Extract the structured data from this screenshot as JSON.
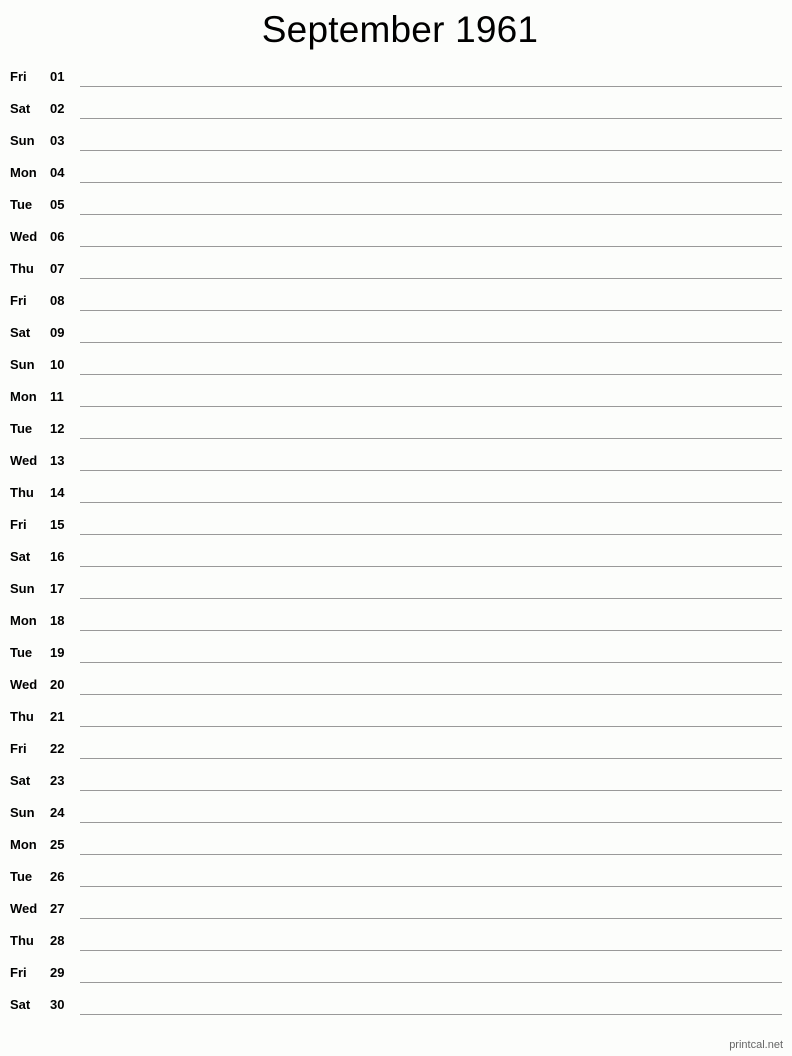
{
  "title": "September 1961",
  "days": [
    {
      "dow": "Fri",
      "day": "01"
    },
    {
      "dow": "Sat",
      "day": "02"
    },
    {
      "dow": "Sun",
      "day": "03"
    },
    {
      "dow": "Mon",
      "day": "04"
    },
    {
      "dow": "Tue",
      "day": "05"
    },
    {
      "dow": "Wed",
      "day": "06"
    },
    {
      "dow": "Thu",
      "day": "07"
    },
    {
      "dow": "Fri",
      "day": "08"
    },
    {
      "dow": "Sat",
      "day": "09"
    },
    {
      "dow": "Sun",
      "day": "10"
    },
    {
      "dow": "Mon",
      "day": "11"
    },
    {
      "dow": "Tue",
      "day": "12"
    },
    {
      "dow": "Wed",
      "day": "13"
    },
    {
      "dow": "Thu",
      "day": "14"
    },
    {
      "dow": "Fri",
      "day": "15"
    },
    {
      "dow": "Sat",
      "day": "16"
    },
    {
      "dow": "Sun",
      "day": "17"
    },
    {
      "dow": "Mon",
      "day": "18"
    },
    {
      "dow": "Tue",
      "day": "19"
    },
    {
      "dow": "Wed",
      "day": "20"
    },
    {
      "dow": "Thu",
      "day": "21"
    },
    {
      "dow": "Fri",
      "day": "22"
    },
    {
      "dow": "Sat",
      "day": "23"
    },
    {
      "dow": "Sun",
      "day": "24"
    },
    {
      "dow": "Mon",
      "day": "25"
    },
    {
      "dow": "Tue",
      "day": "26"
    },
    {
      "dow": "Wed",
      "day": "27"
    },
    {
      "dow": "Thu",
      "day": "28"
    },
    {
      "dow": "Fri",
      "day": "29"
    },
    {
      "dow": "Sat",
      "day": "30"
    }
  ],
  "footer": "printcal.net",
  "colors": {
    "background": "#fcfdfb",
    "rule_line": "#999999",
    "footer_text": "#666666"
  }
}
